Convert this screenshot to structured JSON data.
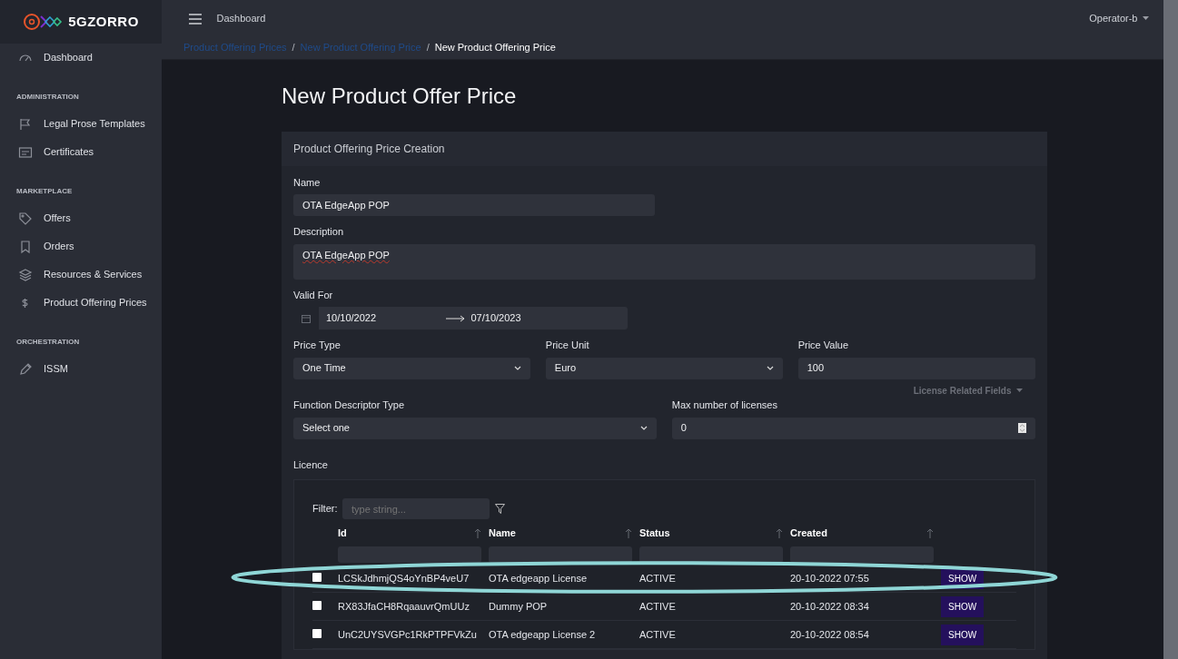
{
  "brand": {
    "name": "5GZORRO"
  },
  "topbar": {
    "link": "Dashboard",
    "user": "Operator-b"
  },
  "breadcrumb": [
    {
      "label": "Product Offering Prices",
      "current": false
    },
    {
      "separator_before": "/",
      "label": "New Product Offering Price",
      "current": false
    },
    {
      "separator_before": "/",
      "label": "New Product Offering Price",
      "current": true
    }
  ],
  "sidebar": {
    "items": [
      {
        "kind": "item",
        "label": "Dashboard"
      },
      {
        "kind": "section",
        "label": "ADMINISTRATION"
      },
      {
        "kind": "item",
        "label": "Legal Prose Templates"
      },
      {
        "kind": "item",
        "label": "Certificates"
      },
      {
        "kind": "section",
        "label": "MARKETPLACE"
      },
      {
        "kind": "item",
        "label": "Offers"
      },
      {
        "kind": "item",
        "label": "Orders"
      },
      {
        "kind": "item",
        "label": "Resources & Services"
      },
      {
        "kind": "item",
        "label": "Product Offering Prices"
      },
      {
        "kind": "section",
        "label": "ORCHESTRATION"
      },
      {
        "kind": "item",
        "label": "ISSM"
      }
    ]
  },
  "page_title": "New Product Offer Price",
  "card": {
    "title": "Product Offering Price Creation",
    "name": {
      "label": "Name",
      "value": "OTA EdgeApp POP"
    },
    "description": {
      "label": "Description",
      "value": "OTA EdgeApp POP"
    },
    "valid_for": {
      "label": "Valid For",
      "start": "10/10/2022",
      "end": "07/10/2023"
    },
    "price_type": {
      "label": "Price Type",
      "value": "One Time"
    },
    "price_unit": {
      "label": "Price Unit",
      "value": "Euro"
    },
    "price_value": {
      "label": "Price Value",
      "value": "100"
    },
    "license_toggle": {
      "label": "License Related Fields",
      "expanded": true
    },
    "function_descriptor_type": {
      "label": "Function Descriptor Type",
      "value": "Select one"
    },
    "max_licenses": {
      "label": "Max number of licenses",
      "value": "0"
    },
    "licence": {
      "label": "Licence",
      "filter_label": "Filter:",
      "filter_placeholder": "type string...",
      "columns": [
        "Id",
        "Name",
        "Status",
        "Created"
      ],
      "rows": [
        {
          "id": "LCSkJdhmjQS4oYnBP4veU7",
          "name": "OTA edgeapp License",
          "status": "ACTIVE",
          "created": "20-10-2022 07:55",
          "action": "SHOW",
          "checked": false,
          "highlighted": true
        },
        {
          "id": "RX83JfaCH8RqaauvrQmUUz",
          "name": "Dummy POP",
          "status": "ACTIVE",
          "created": "20-10-2022 08:34",
          "action": "SHOW",
          "checked": false,
          "highlighted": false
        },
        {
          "id": "UnC2UYSVGPc1RkPTPFVkZu",
          "name": "OTA edgeapp License 2",
          "status": "ACTIVE",
          "created": "20-10-2022 08:54",
          "action": "SHOW",
          "checked": false,
          "highlighted": false
        }
      ]
    }
  }
}
